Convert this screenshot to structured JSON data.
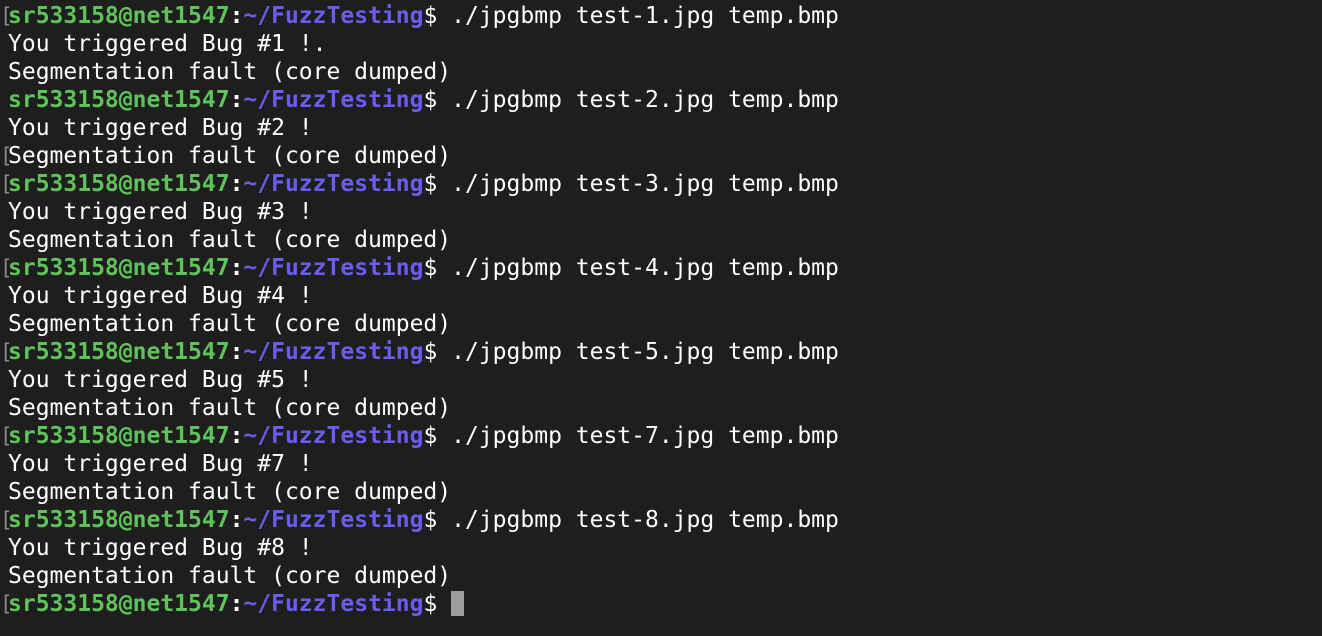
{
  "terminal": {
    "colors": {
      "background": "#1e1e1e",
      "user_host": "#5fc35a",
      "path": "#6a5cf0",
      "text": "#ffffff",
      "cursor": "#9d9d9d",
      "mark": "#8a8a8a"
    },
    "prompt": {
      "user_host": "sr533158@net1547",
      "separator": ":",
      "path": "~/FuzzTesting",
      "dollar": "$"
    },
    "mark_glyph": "[",
    "lines": [
      {
        "type": "prompt",
        "command": " ./jpgbmp test-1.jpg temp.bmp",
        "mark": true
      },
      {
        "type": "output",
        "text": "You triggered Bug #1 !."
      },
      {
        "type": "output",
        "text": "Segmentation fault (core dumped)"
      },
      {
        "type": "prompt",
        "command": " ./jpgbmp test-2.jpg temp.bmp"
      },
      {
        "type": "output",
        "text": "You triggered Bug #2 !"
      },
      {
        "type": "output",
        "text": "Segmentation fault (core dumped)",
        "mark": true
      },
      {
        "type": "prompt",
        "command": " ./jpgbmp test-3.jpg temp.bmp",
        "mark": true
      },
      {
        "type": "output",
        "text": "You triggered Bug #3 !"
      },
      {
        "type": "output",
        "text": "Segmentation fault (core dumped)"
      },
      {
        "type": "prompt",
        "command": " ./jpgbmp test-4.jpg temp.bmp",
        "mark": true
      },
      {
        "type": "output",
        "text": "You triggered Bug #4 !"
      },
      {
        "type": "output",
        "text": "Segmentation fault (core dumped)"
      },
      {
        "type": "prompt",
        "command": " ./jpgbmp test-5.jpg temp.bmp",
        "mark": true
      },
      {
        "type": "output",
        "text": "You triggered Bug #5 !"
      },
      {
        "type": "output",
        "text": "Segmentation fault (core dumped)"
      },
      {
        "type": "prompt",
        "command": " ./jpgbmp test-7.jpg temp.bmp",
        "mark": true
      },
      {
        "type": "output",
        "text": "You triggered Bug #7 !"
      },
      {
        "type": "output",
        "text": "Segmentation fault (core dumped)"
      },
      {
        "type": "prompt",
        "command": " ./jpgbmp test-8.jpg temp.bmp",
        "mark": true
      },
      {
        "type": "output",
        "text": "You triggered Bug #8 !"
      },
      {
        "type": "output",
        "text": "Segmentation fault (core dumped)"
      },
      {
        "type": "prompt",
        "command": " ",
        "mark": true,
        "cursor": true
      }
    ]
  }
}
